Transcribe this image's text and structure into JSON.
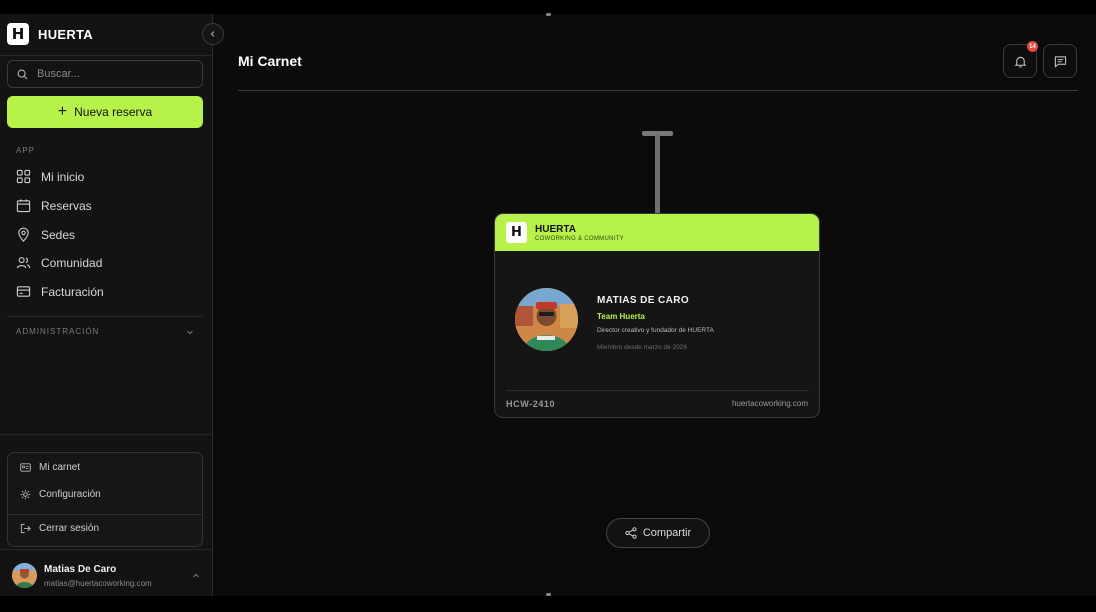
{
  "app": {
    "brand": "HUERTA",
    "logo_letter": "H"
  },
  "search": {
    "placeholder": "Buscar..."
  },
  "new_reservation": {
    "label": "Nueva reserva"
  },
  "sections": {
    "app": "APP",
    "admin": "ADMINISTRACIÓN"
  },
  "nav": [
    {
      "label": "Mi inicio",
      "icon": "dashboard-icon"
    },
    {
      "label": "Reservas",
      "icon": "calendar-icon"
    },
    {
      "label": "Sedes",
      "icon": "map-pin-icon"
    },
    {
      "label": "Comunidad",
      "icon": "users-icon"
    },
    {
      "label": "Facturación",
      "icon": "credit-card-icon"
    }
  ],
  "user_menu": {
    "items": [
      {
        "label": "Mi carnet",
        "icon": "id-card-icon"
      },
      {
        "label": "Configuración",
        "icon": "settings-icon"
      }
    ],
    "logout": {
      "label": "Cerrar sesión",
      "icon": "logout-icon"
    }
  },
  "user": {
    "name": "Matias De Caro",
    "email": "matias@huertacoworking.com"
  },
  "header": {
    "title": "Mi Carnet",
    "notifications_count": "14"
  },
  "badge": {
    "brand": "HUERTA",
    "subtitle": "COWORKING & COMMUNITY",
    "name": "MATIAS DE CARO",
    "team": "Team Huerta",
    "role": "Director creativo y fundador de HUERTA",
    "member_since": "Miembro desde marzo de 2026",
    "code": "HCW-2410",
    "website": "huertacoworking.com"
  },
  "share": {
    "label": "Compartir"
  },
  "colors": {
    "accent": "#b6f24a",
    "background": "#0b0b0b",
    "sidebar": "#131313",
    "badge_notification": "#e5483f"
  }
}
